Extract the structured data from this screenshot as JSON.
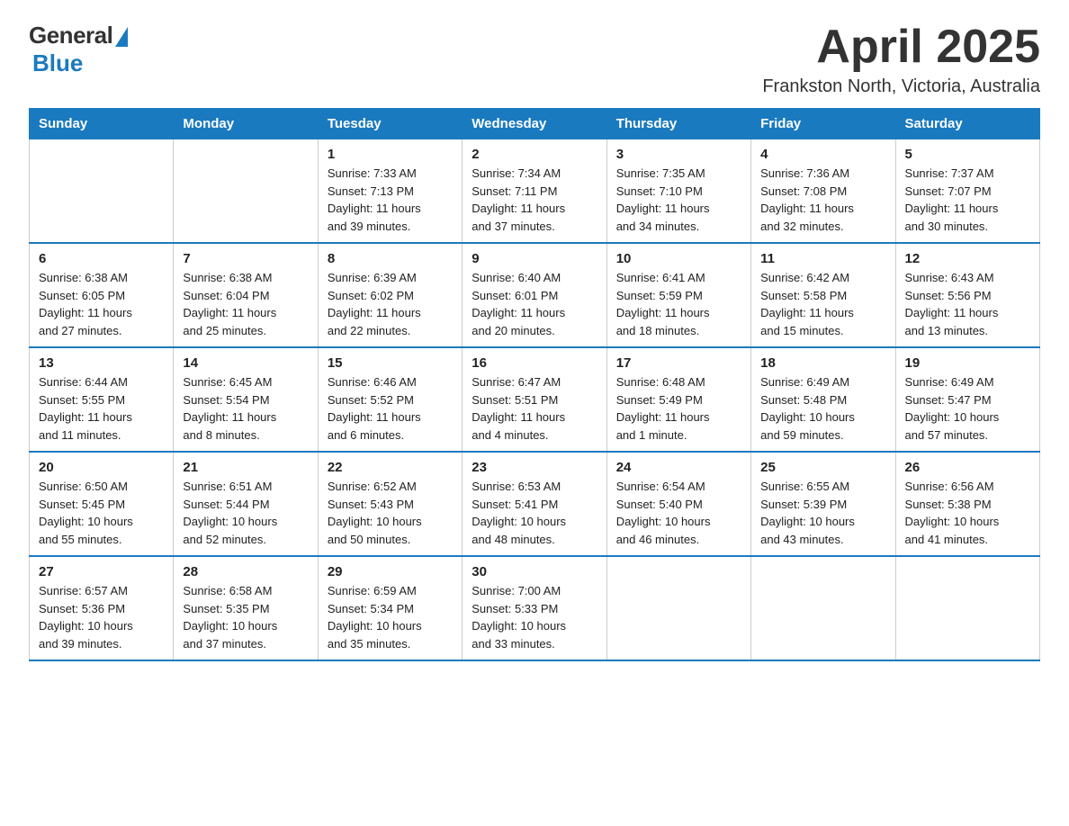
{
  "header": {
    "logo_general": "General",
    "logo_blue": "Blue",
    "title": "April 2025",
    "subtitle": "Frankston North, Victoria, Australia"
  },
  "days_header": [
    "Sunday",
    "Monday",
    "Tuesday",
    "Wednesday",
    "Thursday",
    "Friday",
    "Saturday"
  ],
  "weeks": [
    [
      {
        "num": "",
        "info": ""
      },
      {
        "num": "",
        "info": ""
      },
      {
        "num": "1",
        "info": "Sunrise: 7:33 AM\nSunset: 7:13 PM\nDaylight: 11 hours\nand 39 minutes."
      },
      {
        "num": "2",
        "info": "Sunrise: 7:34 AM\nSunset: 7:11 PM\nDaylight: 11 hours\nand 37 minutes."
      },
      {
        "num": "3",
        "info": "Sunrise: 7:35 AM\nSunset: 7:10 PM\nDaylight: 11 hours\nand 34 minutes."
      },
      {
        "num": "4",
        "info": "Sunrise: 7:36 AM\nSunset: 7:08 PM\nDaylight: 11 hours\nand 32 minutes."
      },
      {
        "num": "5",
        "info": "Sunrise: 7:37 AM\nSunset: 7:07 PM\nDaylight: 11 hours\nand 30 minutes."
      }
    ],
    [
      {
        "num": "6",
        "info": "Sunrise: 6:38 AM\nSunset: 6:05 PM\nDaylight: 11 hours\nand 27 minutes."
      },
      {
        "num": "7",
        "info": "Sunrise: 6:38 AM\nSunset: 6:04 PM\nDaylight: 11 hours\nand 25 minutes."
      },
      {
        "num": "8",
        "info": "Sunrise: 6:39 AM\nSunset: 6:02 PM\nDaylight: 11 hours\nand 22 minutes."
      },
      {
        "num": "9",
        "info": "Sunrise: 6:40 AM\nSunset: 6:01 PM\nDaylight: 11 hours\nand 20 minutes."
      },
      {
        "num": "10",
        "info": "Sunrise: 6:41 AM\nSunset: 5:59 PM\nDaylight: 11 hours\nand 18 minutes."
      },
      {
        "num": "11",
        "info": "Sunrise: 6:42 AM\nSunset: 5:58 PM\nDaylight: 11 hours\nand 15 minutes."
      },
      {
        "num": "12",
        "info": "Sunrise: 6:43 AM\nSunset: 5:56 PM\nDaylight: 11 hours\nand 13 minutes."
      }
    ],
    [
      {
        "num": "13",
        "info": "Sunrise: 6:44 AM\nSunset: 5:55 PM\nDaylight: 11 hours\nand 11 minutes."
      },
      {
        "num": "14",
        "info": "Sunrise: 6:45 AM\nSunset: 5:54 PM\nDaylight: 11 hours\nand 8 minutes."
      },
      {
        "num": "15",
        "info": "Sunrise: 6:46 AM\nSunset: 5:52 PM\nDaylight: 11 hours\nand 6 minutes."
      },
      {
        "num": "16",
        "info": "Sunrise: 6:47 AM\nSunset: 5:51 PM\nDaylight: 11 hours\nand 4 minutes."
      },
      {
        "num": "17",
        "info": "Sunrise: 6:48 AM\nSunset: 5:49 PM\nDaylight: 11 hours\nand 1 minute."
      },
      {
        "num": "18",
        "info": "Sunrise: 6:49 AM\nSunset: 5:48 PM\nDaylight: 10 hours\nand 59 minutes."
      },
      {
        "num": "19",
        "info": "Sunrise: 6:49 AM\nSunset: 5:47 PM\nDaylight: 10 hours\nand 57 minutes."
      }
    ],
    [
      {
        "num": "20",
        "info": "Sunrise: 6:50 AM\nSunset: 5:45 PM\nDaylight: 10 hours\nand 55 minutes."
      },
      {
        "num": "21",
        "info": "Sunrise: 6:51 AM\nSunset: 5:44 PM\nDaylight: 10 hours\nand 52 minutes."
      },
      {
        "num": "22",
        "info": "Sunrise: 6:52 AM\nSunset: 5:43 PM\nDaylight: 10 hours\nand 50 minutes."
      },
      {
        "num": "23",
        "info": "Sunrise: 6:53 AM\nSunset: 5:41 PM\nDaylight: 10 hours\nand 48 minutes."
      },
      {
        "num": "24",
        "info": "Sunrise: 6:54 AM\nSunset: 5:40 PM\nDaylight: 10 hours\nand 46 minutes."
      },
      {
        "num": "25",
        "info": "Sunrise: 6:55 AM\nSunset: 5:39 PM\nDaylight: 10 hours\nand 43 minutes."
      },
      {
        "num": "26",
        "info": "Sunrise: 6:56 AM\nSunset: 5:38 PM\nDaylight: 10 hours\nand 41 minutes."
      }
    ],
    [
      {
        "num": "27",
        "info": "Sunrise: 6:57 AM\nSunset: 5:36 PM\nDaylight: 10 hours\nand 39 minutes."
      },
      {
        "num": "28",
        "info": "Sunrise: 6:58 AM\nSunset: 5:35 PM\nDaylight: 10 hours\nand 37 minutes."
      },
      {
        "num": "29",
        "info": "Sunrise: 6:59 AM\nSunset: 5:34 PM\nDaylight: 10 hours\nand 35 minutes."
      },
      {
        "num": "30",
        "info": "Sunrise: 7:00 AM\nSunset: 5:33 PM\nDaylight: 10 hours\nand 33 minutes."
      },
      {
        "num": "",
        "info": ""
      },
      {
        "num": "",
        "info": ""
      },
      {
        "num": "",
        "info": ""
      }
    ]
  ]
}
